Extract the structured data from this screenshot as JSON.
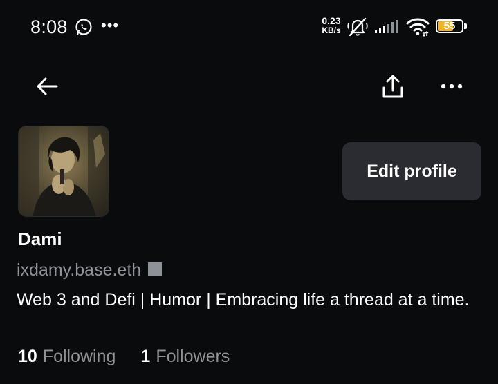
{
  "status_bar": {
    "time": "8:08",
    "notification_overflow": "•••",
    "net_speed_value": "0.23",
    "net_speed_unit": "KB/s",
    "battery_level": "55",
    "icons": [
      "whatsapp-icon",
      "bell-muted-icon",
      "cell-signal-icon",
      "wifi-icon",
      "battery-icon"
    ]
  },
  "header": {
    "back_icon": "arrow-left-icon",
    "share_icon": "share-upload-icon",
    "more_icon": "more-horizontal-icon",
    "more_label": "•••"
  },
  "profile": {
    "display_name": "Dami",
    "handle": "ixdamy.base.eth",
    "bio": "Web 3 and Defi | Humor | Embracing life a thread at a time.",
    "edit_button_label": "Edit profile",
    "following_count": "10",
    "following_label": "Following",
    "followers_count": "1",
    "followers_label": "Followers"
  },
  "colors": {
    "background": "#0a0b0d",
    "button_bg": "#2a2c31",
    "muted_text": "#8e9196",
    "battery_fill": "#f0b429"
  }
}
